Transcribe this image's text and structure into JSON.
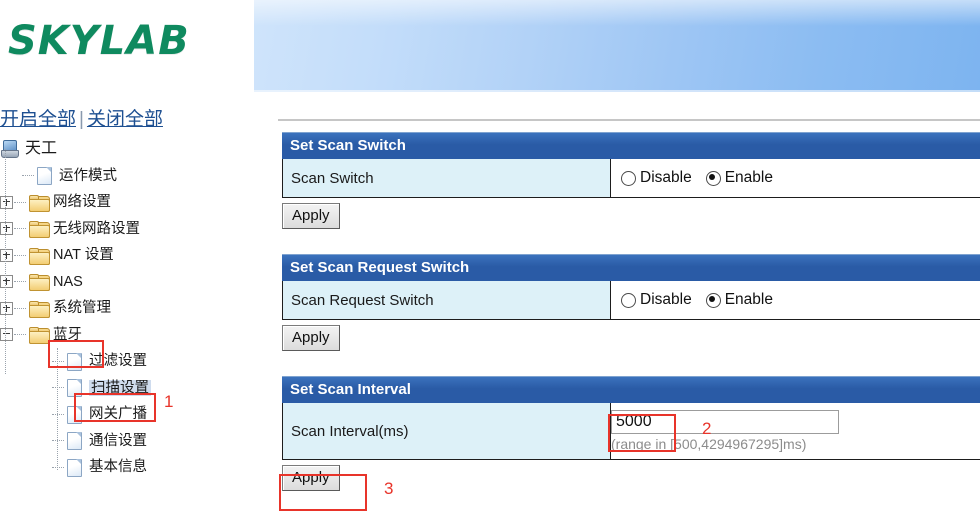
{
  "brand": {
    "logo_text": "SKYLAB"
  },
  "sidebar": {
    "expand_all": "开启全部",
    "separator": "|",
    "collapse_all": "关闭全部",
    "tree": [
      {
        "label": "天工",
        "icon": "computer-icon",
        "level": 0,
        "type": "root",
        "expander": "none"
      },
      {
        "label": "运作模式",
        "icon": "document-icon",
        "level": 1,
        "type": "leaf",
        "expander": "none"
      },
      {
        "label": "网络设置",
        "icon": "folder-icon",
        "level": 1,
        "type": "folder",
        "expander": "plus"
      },
      {
        "label": "无线网路设置",
        "icon": "folder-icon",
        "level": 1,
        "type": "folder",
        "expander": "plus"
      },
      {
        "label": "NAT 设置",
        "icon": "folder-icon",
        "level": 1,
        "type": "folder",
        "expander": "plus"
      },
      {
        "label": "NAS",
        "icon": "folder-icon",
        "level": 1,
        "type": "folder",
        "expander": "plus"
      },
      {
        "label": "系统管理",
        "icon": "folder-icon",
        "level": 1,
        "type": "folder",
        "expander": "plus"
      },
      {
        "label": "蓝牙",
        "icon": "folder-icon",
        "level": 1,
        "type": "folder",
        "expander": "minus"
      },
      {
        "label": "过滤设置",
        "icon": "document-icon",
        "level": 2,
        "type": "leaf",
        "expander": "none"
      },
      {
        "label": "扫描设置",
        "icon": "document-icon",
        "level": 2,
        "type": "leaf",
        "expander": "none",
        "selected": true
      },
      {
        "label": "网关广播",
        "icon": "document-icon",
        "level": 2,
        "type": "leaf",
        "expander": "none"
      },
      {
        "label": "通信设置",
        "icon": "document-icon",
        "level": 2,
        "type": "leaf",
        "expander": "none"
      },
      {
        "label": "基本信息",
        "icon": "document-icon",
        "level": 2,
        "type": "leaf",
        "expander": "none"
      }
    ]
  },
  "main": {
    "sections": [
      {
        "title": "Set Scan Switch",
        "row_label": "Scan Switch",
        "control": "radio",
        "options": [
          {
            "label": "Disable",
            "selected": false
          },
          {
            "label": "Enable",
            "selected": true
          }
        ],
        "apply_label": "Apply"
      },
      {
        "title": "Set Scan Request Switch",
        "row_label": "Scan Request Switch",
        "control": "radio",
        "options": [
          {
            "label": "Disable",
            "selected": false
          },
          {
            "label": "Enable",
            "selected": true
          }
        ],
        "apply_label": "Apply"
      },
      {
        "title": "Set Scan Interval",
        "row_label": "Scan Interval(ms)",
        "control": "text",
        "value": "5000",
        "hint": "(range in [500,4294967295]ms)",
        "apply_label": "Apply"
      }
    ]
  },
  "annotations": {
    "step1": "1",
    "step2": "2",
    "step3": "3"
  },
  "colors": {
    "brand_green": "#0f8a5f",
    "section_header_blue": "#2a5ba6",
    "label_cell_blue": "#ddf1f8",
    "link_blue": "#1d4f91",
    "annotation_red": "#e8342a",
    "banner_blue": "#8bbcf2"
  }
}
